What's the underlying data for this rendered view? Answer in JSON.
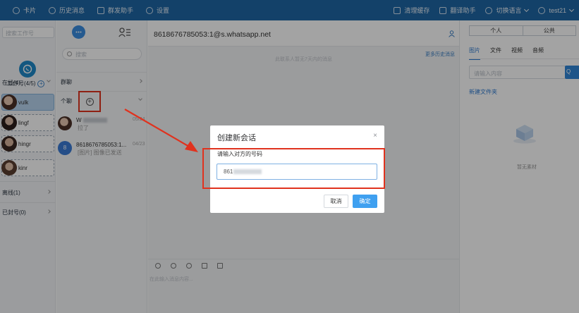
{
  "topnav": {
    "left": [
      {
        "label": "卡片",
        "icon": "chat-circle-icon",
        "active": true
      },
      {
        "label": "历史消息",
        "icon": "history-clock-icon",
        "active": false
      },
      {
        "label": "群发助手",
        "icon": "send-plane-icon",
        "active": false
      },
      {
        "label": "设置",
        "icon": "gear-icon",
        "active": false
      }
    ],
    "right": [
      {
        "label": "清理缓存",
        "icon": "clean-icon"
      },
      {
        "label": "翻译助手",
        "icon": "translate-icon"
      },
      {
        "label": "切换语言",
        "icon": "globe-icon"
      },
      {
        "label": "test21",
        "icon": "user-icon"
      }
    ]
  },
  "accounts": {
    "search_placeholder": "搜索工作号",
    "count_label": "工作号(4/5)",
    "online_label": "在线(4)",
    "items": [
      {
        "name": "vulk",
        "selected": true
      },
      {
        "name": "lingf",
        "selected": false
      },
      {
        "name": "hingr",
        "selected": false
      },
      {
        "name": "kinr",
        "selected": false
      }
    ],
    "offline_label": "离线(1)",
    "banned_label": "已封号(0)"
  },
  "chatlist": {
    "search_placeholder": "搜索",
    "group_label": "群聊",
    "private_label": "个聊",
    "chats": [
      {
        "name": "W",
        "preview": "拉了",
        "time": "05/24"
      },
      {
        "name": "8618676785053:1...",
        "preview": "[图片] 图像已发送",
        "time": "04/23",
        "badge": "8"
      }
    ]
  },
  "chat": {
    "jid": "8618676785053:1@s.whatsapp.net",
    "hint": "此联系人暂无7天内的消息",
    "more_history": "更多历史消息",
    "input_placeholder": "在此输入消息内容..."
  },
  "library": {
    "seg": [
      "个人",
      "公共"
    ],
    "tabs": [
      "图片",
      "文件",
      "视频",
      "音频"
    ],
    "search_placeholder": "请输入内容",
    "search_button": "Q",
    "new_folder": "新建文件夹",
    "empty_text": "暂无素材"
  },
  "dialog": {
    "title": "创建新会话",
    "close": "×",
    "label": "请输入对方的号码",
    "input_value": "861",
    "cancel": "取消",
    "confirm": "确定"
  },
  "colors": {
    "topbar": "#1e67a5",
    "accent": "#2f86d6",
    "annotation": "#e0321e"
  }
}
